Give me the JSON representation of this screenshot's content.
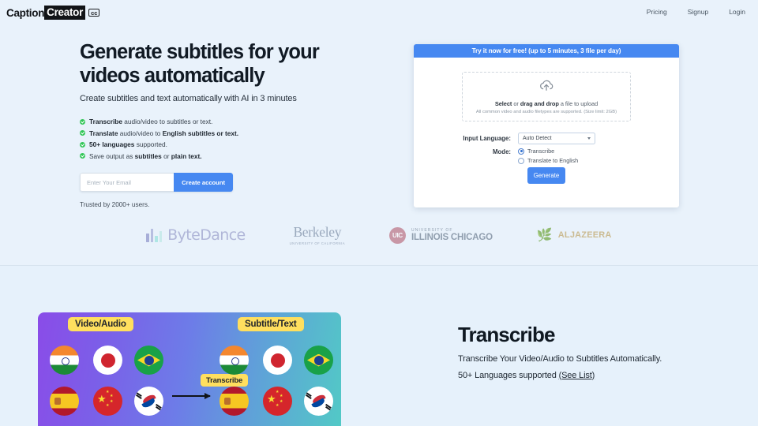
{
  "nav": {
    "logo": {
      "part1": "Caption",
      "part2": "Creator",
      "badge": "cc"
    },
    "links": [
      {
        "label": "Pricing"
      },
      {
        "label": "Signup"
      },
      {
        "label": "Login"
      }
    ]
  },
  "hero": {
    "title_line1": "Generate subtitles for your",
    "title_line2": "videos automatically",
    "subtitle": "Create subtitles and text automatically with AI in 3 minutes",
    "features": [
      {
        "bold1": "Transcribe",
        "text1": " audio/video to subtitles or text.",
        "bold2": "",
        "text2": ""
      },
      {
        "bold1": "Translate",
        "text1": " audio/video to ",
        "bold2": "English subtitles or text.",
        "text2": ""
      },
      {
        "bold1": "50+ languages",
        "text1": " supported.",
        "bold2": "",
        "text2": ""
      },
      {
        "bold1": "",
        "text1": "Save output as ",
        "bold2": "subtitles",
        "text2": " or ",
        "bold3": "plain text.",
        "text3": ""
      }
    ],
    "email_placeholder": "Enter Your Email",
    "email_value": "",
    "create_account_label": "Create account",
    "trusted_text": "Trusted by 2000+ users."
  },
  "upload_card": {
    "banner": "Try it now for free! (up to 5 minutes, 3 file per day)",
    "dropzone": {
      "main_bold_1": "Select",
      "main_plain_1": " or ",
      "main_bold_2": "drag and drop",
      "main_plain_2": " a file to upload",
      "sub": "All common video and audio filetypes are supported. (Size limit: 2GB)",
      "icon": "cloud-upload-icon"
    },
    "input_language_label": "Input Language:",
    "input_language_value": "Auto Detect",
    "mode_label": "Mode:",
    "mode_options": [
      {
        "label": "Transcribe",
        "selected": true
      },
      {
        "label": "Translate to English",
        "selected": false
      }
    ],
    "generate_label": "Generate",
    "accent_color": "#4688f1"
  },
  "brands": [
    {
      "name": "ByteDance"
    },
    {
      "name": "Berkeley",
      "sub": "UNIVERSITY OF CALIFORNIA"
    },
    {
      "badge": "UIC",
      "top": "UNIVERSITY OF",
      "bottom": "ILLINOIS CHICAGO"
    },
    {
      "name": "ALJAZEERA"
    }
  ],
  "illustration": {
    "tag_left": "Video/Audio",
    "tag_right": "Subtitle/Text",
    "tag_center": "Transcribe",
    "flags_left": [
      "india-flag",
      "japan-flag",
      "brazil-flag",
      "spain-flag",
      "china-flag",
      "south-korea-flag"
    ],
    "flags_right": [
      "india-flag",
      "japan-flag",
      "brazil-flag",
      "spain-flag",
      "china-flag",
      "south-korea-flag"
    ]
  },
  "transcribe_section": {
    "title": "Transcribe",
    "line1": "Transcribe Your Video/Audio to Subtitles Automatically.",
    "line2_prefix": "50+ Languages supported ",
    "line2_link": "(See List)"
  }
}
